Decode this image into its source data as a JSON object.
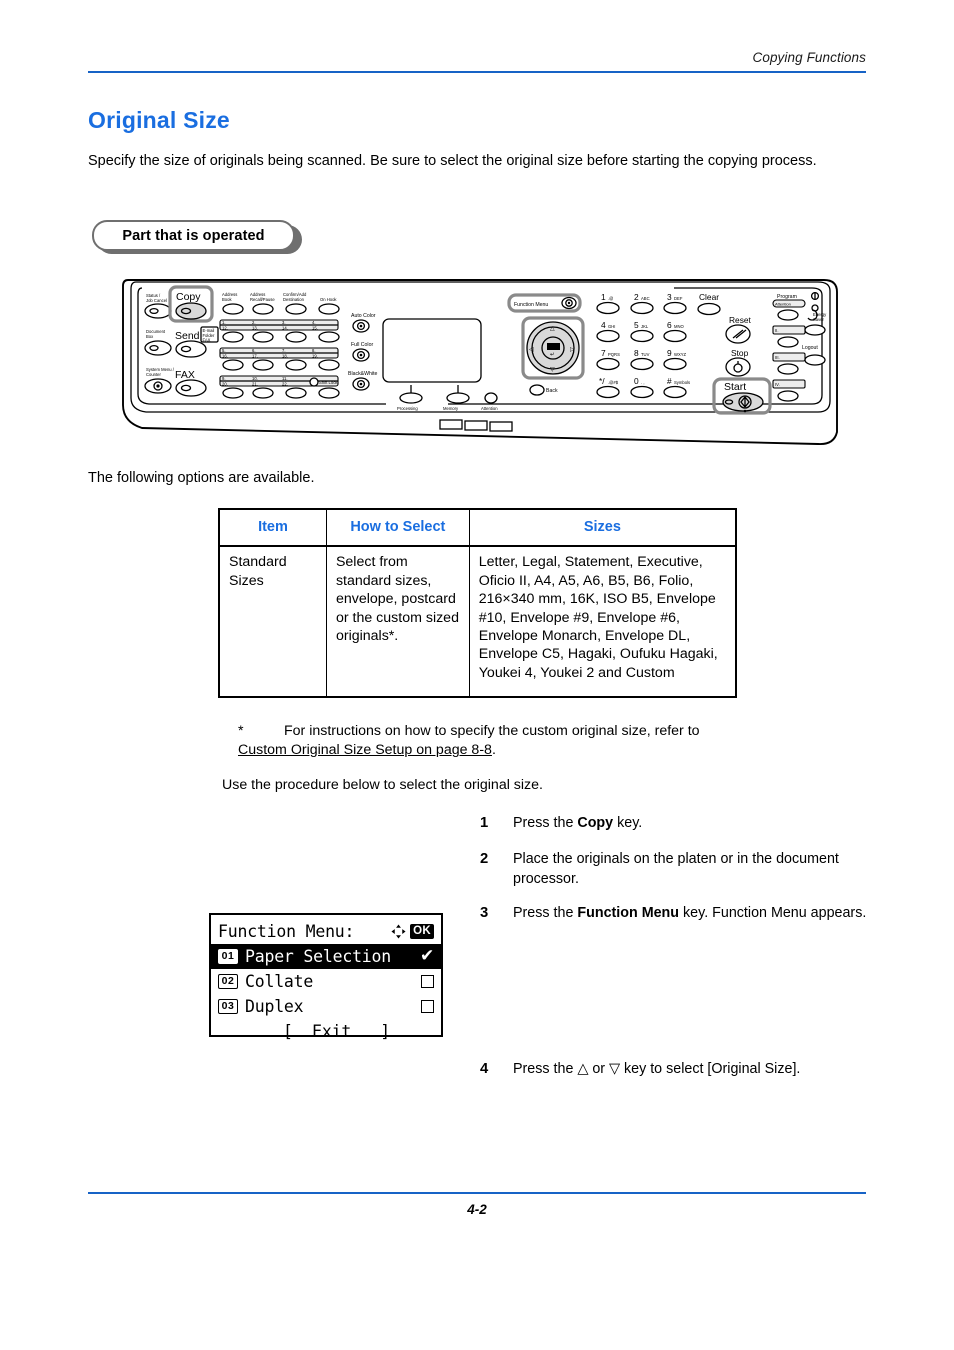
{
  "header": {
    "running_head": "Copying Functions",
    "rule_color": "#1763c6"
  },
  "heading": {
    "title": "Original Size",
    "color": "#1a6ee0"
  },
  "intro": "Specify the size of originals being scanned. Be sure to select the original size before starting the copying process.",
  "callout": {
    "label": "Part that is operated"
  },
  "panel": {
    "left_keys": [
      "Status / Job Cancel",
      "Copy",
      "Document Box",
      "Send",
      "System Menu / Counter",
      "FAX"
    ],
    "send_tag": [
      "E-mail",
      "Folder",
      "FAX"
    ],
    "top_keys": [
      "Address Book",
      "Address Recall/Pause",
      "Confirm/Add Destination",
      "On Hook"
    ],
    "shift_lock": "Shift Lock",
    "color_keys": [
      "Auto Color",
      "Full Color",
      "Black&White"
    ],
    "indicators": [
      "Processing",
      "Memory",
      "Attention"
    ],
    "function_menu": "Function Menu",
    "ok_key": "OK",
    "back_key": "Back",
    "keypad": [
      {
        "digit": "1",
        "letters": ".@"
      },
      {
        "digit": "2",
        "letters": "ABC"
      },
      {
        "digit": "3",
        "letters": "DEF"
      },
      {
        "digit": "4",
        "letters": "GHI"
      },
      {
        "digit": "5",
        "letters": "JKL"
      },
      {
        "digit": "6",
        "letters": "MNO"
      },
      {
        "digit": "7",
        "letters": "PQRS"
      },
      {
        "digit": "8",
        "letters": "TUV"
      },
      {
        "digit": "9",
        "letters": "WXYZ"
      },
      {
        "digit": "*/",
        "letters": ".@#$%"
      },
      {
        "digit": "0",
        "letters": ".."
      },
      {
        "digit": "#",
        "letters": "Symbols"
      }
    ],
    "clear_key": "Clear",
    "reset_key": "Reset",
    "stop_key": "Stop",
    "start_key": "Start",
    "program_key": "Program",
    "program_sub": "Attention",
    "energy_saver": "Energy Saver",
    "logout_key": "Logout"
  },
  "options_lead": "The following options are available.",
  "table": {
    "headers": [
      "Item",
      "How to Select",
      "Sizes"
    ],
    "rows": [
      {
        "item": "Standard Sizes",
        "how": "Select from standard sizes, envelope, postcard or the custom sized originals*.",
        "sizes": "Letter, Legal, Statement, Executive, Oficio II, A4, A5, A6, B5, B6, Folio, 216×340 mm, 16K, ISO B5, Envelope #10, Envelope #9, Envelope #6, Envelope Monarch, Envelope DL, Envelope C5, Hagaki, Oufuku Hagaki, Youkei 4, Youkei 2 and Custom"
      }
    ]
  },
  "footnote": {
    "marker": "*",
    "text_before": "For instructions on how to specify the custom original size, refer to ",
    "link": "Custom Original Size Setup on page 8-8",
    "text_after": "."
  },
  "procedure_lead": "Use the procedure below to select the original size.",
  "steps": [
    {
      "num": "1",
      "pre": "Press the ",
      "bold": "Copy",
      "post": " key."
    },
    {
      "num": "2",
      "pre": "Place the originals on the platen or in the document processor.",
      "bold": "",
      "post": ""
    },
    {
      "num": "3",
      "pre": "Press the ",
      "bold": "Function Menu",
      "post": " key. Function Menu appears."
    },
    {
      "num": "4",
      "pre": "Press the △ or ▽ key to select [Original Size].",
      "bold": "",
      "post": ""
    }
  ],
  "lcd": {
    "title": "Function Menu:",
    "ok_badge": "OK",
    "items": [
      {
        "index": "01",
        "label": "Paper Selection",
        "state": "checked",
        "selected": true
      },
      {
        "index": "02",
        "label": "Collate",
        "state": "unchecked",
        "selected": false
      },
      {
        "index": "03",
        "label": "Duplex",
        "state": "unchecked",
        "selected": false
      }
    ],
    "exit": "[  Exit   ]"
  },
  "footer": {
    "page_number": "4-2"
  }
}
